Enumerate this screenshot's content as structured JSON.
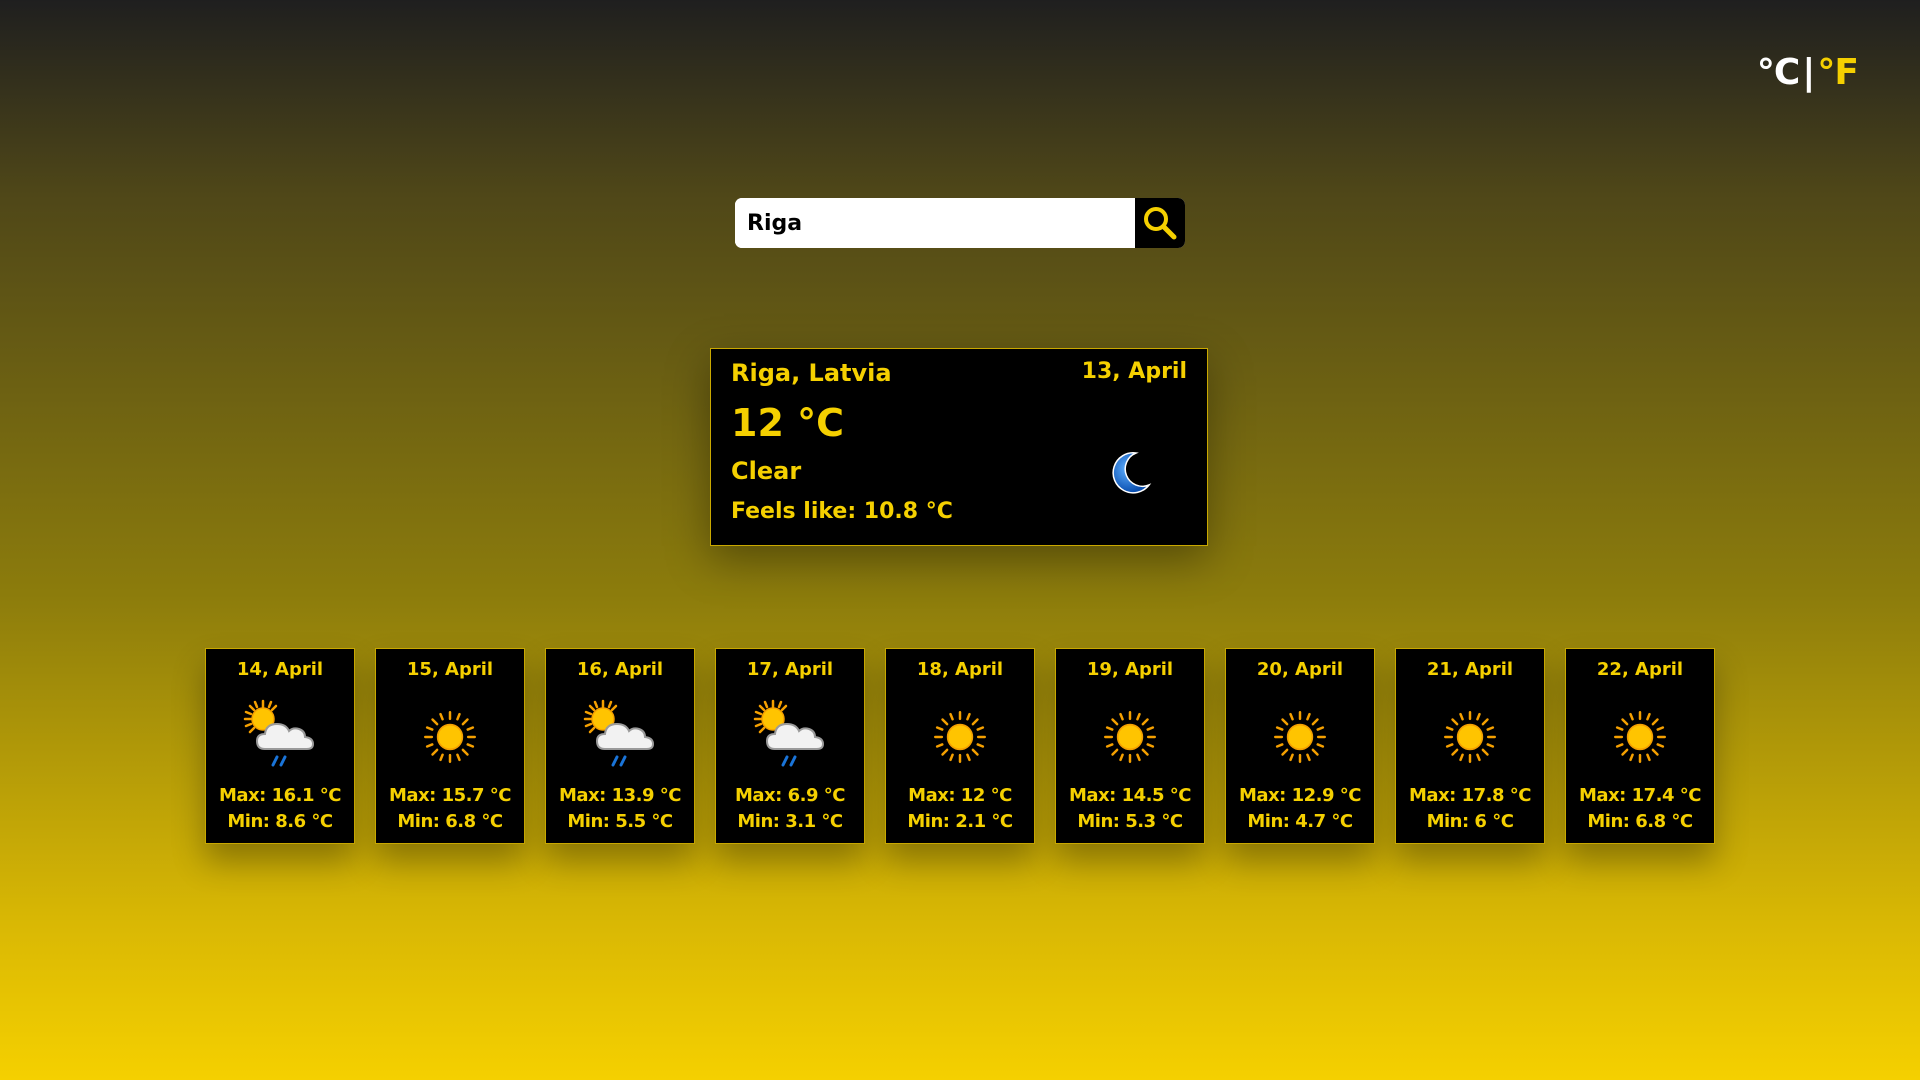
{
  "units": {
    "celsius_label": "°C",
    "separator": "|",
    "fahrenheit_label": "°F"
  },
  "search": {
    "value": "Riga",
    "icon": "search-icon"
  },
  "current": {
    "location": "Riga, Latvia",
    "date": "13, April",
    "temp": "12 °C",
    "description": "Clear",
    "feels_like": "Feels like: 10.8 °C",
    "icon": "moon-icon"
  },
  "forecast": [
    {
      "date": "14, April",
      "icon": "sun-cloud-rain-icon",
      "max": "Max: 16.1 °C",
      "min": "Min: 8.6 °C"
    },
    {
      "date": "15, April",
      "icon": "sun-icon",
      "max": "Max: 15.7 °C",
      "min": "Min: 6.8 °C"
    },
    {
      "date": "16, April",
      "icon": "sun-cloud-rain-icon",
      "max": "Max: 13.9 °C",
      "min": "Min: 5.5 °C"
    },
    {
      "date": "17, April",
      "icon": "sun-cloud-rain-icon",
      "max": "Max: 6.9 °C",
      "min": "Min: 3.1 °C"
    },
    {
      "date": "18, April",
      "icon": "sun-icon",
      "max": "Max: 12 °C",
      "min": "Min: 2.1 °C"
    },
    {
      "date": "19, April",
      "icon": "sun-icon",
      "max": "Max: 14.5 °C",
      "min": "Min: 5.3 °C"
    },
    {
      "date": "20, April",
      "icon": "sun-icon",
      "max": "Max: 12.9 °C",
      "min": "Min: 4.7 °C"
    },
    {
      "date": "21, April",
      "icon": "sun-icon",
      "max": "Max: 17.8 °C",
      "min": "Min: 6 °C"
    },
    {
      "date": "22, April",
      "icon": "sun-icon",
      "max": "Max: 17.4 °C",
      "min": "Min: 6.8 °C"
    }
  ],
  "colors": {
    "accent": "#f5d000",
    "card_bg": "#000000",
    "moon_blue": "#1a74d8"
  }
}
